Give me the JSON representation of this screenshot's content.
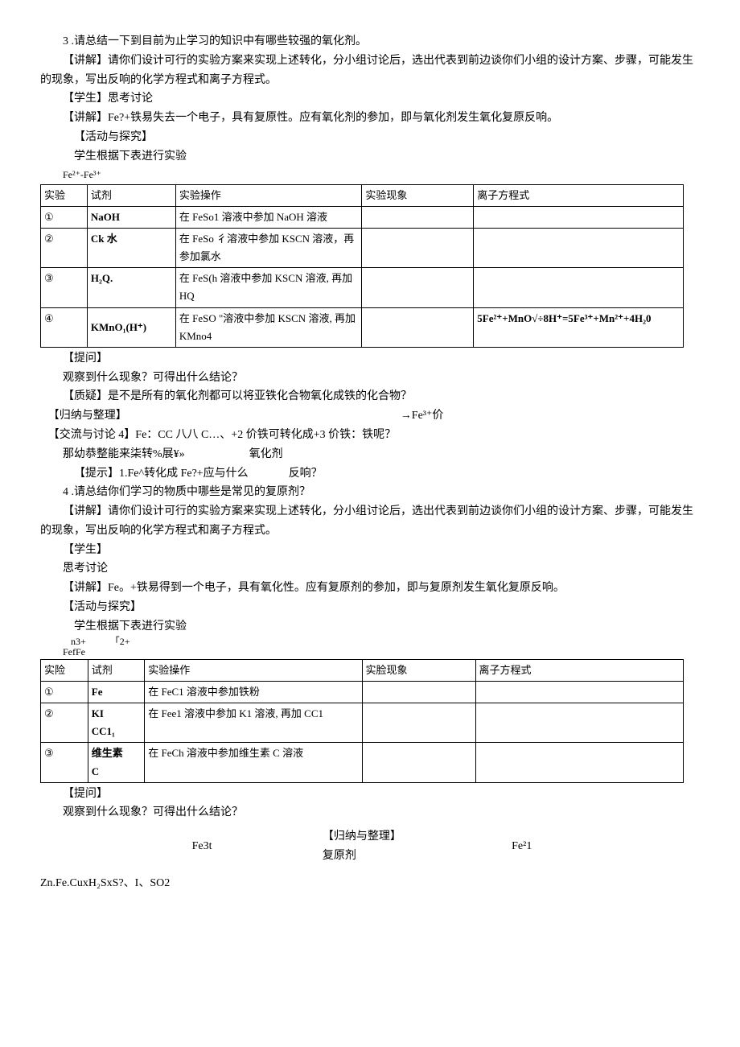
{
  "p": {
    "q3": "3 .请总结一下到目前为止学习的知识中有哪些较强的氧化剂。",
    "jj1": "【讲解】请你们设计可行的实验方案来实现上述转化，分小组讨论后，选出代表到前边谈你们小组的设计方案、步骤，可能发生的现象，写出反响的化学方程式和离子方程式。",
    "xs1": "【学生】思考讨论",
    "jj2": "【讲解】Fe?+铁易失去一个电子，具有复原性。应有氧化剂的参加，即与氧化剂发生氧化复原反响。",
    "hd1": "【活动与探究】",
    "hd1_note": "学生根据下表进行实验",
    "formula1": "Fe²⁺-Fe³⁺",
    "tw1": "【提问】",
    "tw1_q": "观察到什么现象？可得出什么结论？",
    "zy1": "【质疑】是不是所有的氧化剂都可以将亚铁化合物氧化成铁的化合物？",
    "gn1": "【归纳与整理】",
    "gn1_r": "→Fe³⁺价",
    "jl4": "【交流与讨论 4】Fe：CC 八八 C…、+2 价铁可转化成+3 价铁：铁呢？",
    "jl4b": "那幼恭整能来柒转%展¥»",
    "jl4b_r": "氧化剂",
    "ts1": "【提示】1.Fe^转化成 Fe?+应与什么",
    "ts1_r": "反响？",
    "q4": "4 .请总结你们学习的物质中哪些是常见的复原剂？",
    "jj3": "【讲解】请你们设计可行的实验方案来实现上述转化，分小组讨论后，选出代表到前边谈你们小组的设计方案、步骤，可能发生的现象，写出反响的化学方程式和离子方程式。",
    "xs2_a": "【学生】",
    "xs2_b": "思考讨论",
    "jj4": "【讲解】Fe。+铁易得到一个电子，具有氧化性。应有复原剂的参加，即与复原剂发生氧化复原反响。",
    "hd2": "【活动与探究】",
    "hd2_note": "学生根据下表进行实验",
    "formula2a": "n3+",
    "formula2b": "「2+",
    "formula2c": "FefFe",
    "tw2": "【提问】",
    "tw2_q": "观察到什么现象？可得出什么结论？",
    "bottom_a": "Fe3t",
    "bottom_b1": "【归纳与整理】",
    "bottom_b2": "复原剂",
    "bottom_c": "Fe²1",
    "bottom_list": "Zn.Fe.CuxH₂SxS?、I、SO2"
  },
  "table1": {
    "h1": "实验",
    "h2": "试剂",
    "h3": "实验操作",
    "h4": "实验现象",
    "h5": "离子方程式",
    "r1_id": "①",
    "r1_reagent": "NaOH",
    "r1_op": "在 FeSo1 溶液中参加 NaOH 溶液",
    "r2_id": "②",
    "r2_reagent": "Ck 水",
    "r2_op": "在 FeSo 彳溶液中参加 KSCN 溶液，再参加氯水",
    "r3_id": "③",
    "r3_reagent": "H₂Q.",
    "r3_op": "在 FeS(h 溶液中参加 KSCN 溶液, 再加 HQ",
    "r4_id": "④",
    "r4_reagent": "KMnO₁(H⁺)",
    "r4_op": "在 FeSO \"溶液中参加 KSCN 溶液, 再加 KMno4",
    "r4_eq": "5Fe²⁺+MnO√÷8H⁺=5Fe³⁺+Mn²⁺+4H₂0"
  },
  "table2": {
    "h1": "实险",
    "h2": "试剂",
    "h3": "实验操作",
    "h4": "实脸现象",
    "h5": "离子方程式",
    "r1_id": "①",
    "r1_reagent": "Fe",
    "r1_op": "在 FeC1 溶液中参加铁粉",
    "r2_id": "②",
    "r2_reagent": "KI\nCC1₁",
    "r2_op": "在 Fee1 溶液中参加 K1 溶液, 再加 CC1",
    "r3_id": "③",
    "r3_reagent": "维生素\nC",
    "r3_op": "在 FeCh 溶液中参加维生素 C 溶液"
  }
}
